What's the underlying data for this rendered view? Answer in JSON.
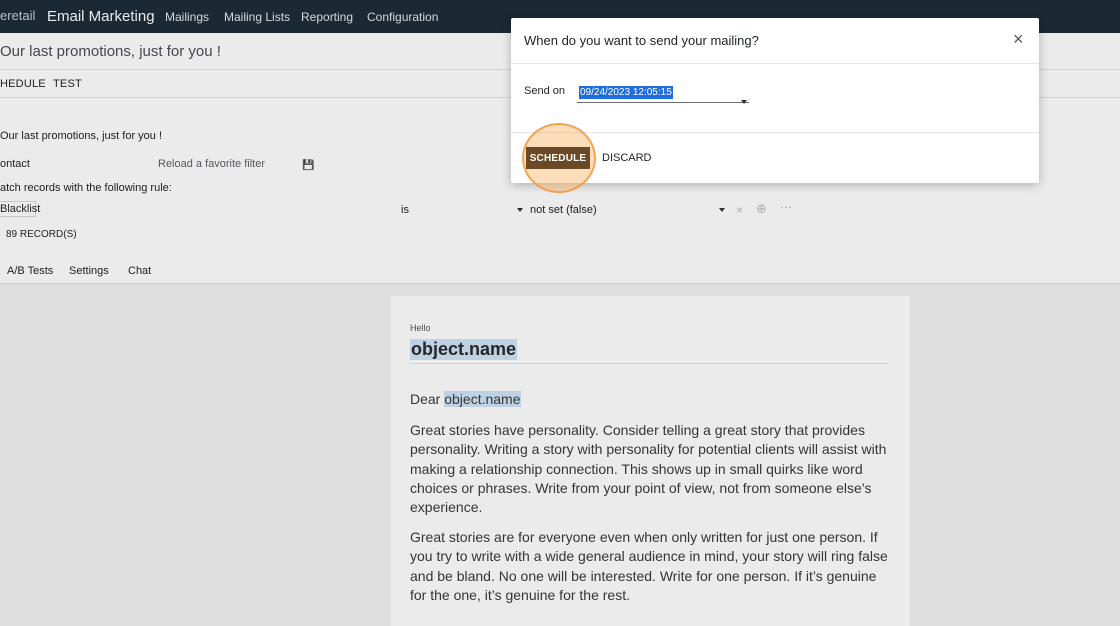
{
  "navbar": {
    "brand": "eretail",
    "app_name": "Email Marketing",
    "menu": [
      "Mailings",
      "Mailing Lists",
      "Reporting",
      "Configuration"
    ]
  },
  "form": {
    "title": "Our last promotions, just for you !",
    "buttons": [
      "HEDULE",
      "TEST"
    ],
    "subject": "Our last promotions, just for you !",
    "recipients": "ontact",
    "reload_filter": "Reload a favorite filter",
    "rule_intro": "atch records with the following rule:",
    "rule_field": "Blacklist",
    "rule_operator": "is",
    "rule_value": "not set (false)",
    "record_count": "89 RECORD(S)",
    "tabs": [
      "A/B Tests",
      "Settings",
      "Chat"
    ]
  },
  "email": {
    "hello": "Hello",
    "heading": "object.name",
    "dear_prefix": "Dear ",
    "dear_name": "object.name",
    "paragraph1": "Great stories have personality. Consider telling a great story that provides personality. Writing a story with personality for potential clients will assist with making a relationship connection. This shows up in small quirks like word choices or phrases. Write from your point of view, not from someone else's experience.",
    "paragraph2": "Great stories are for everyone even when only written for just one person. If you try to write with a wide general audience in mind, your story will ring false and be bland. No one will be interested. Write for one person. If it’s genuine for the one, it’s genuine for the rest."
  },
  "modal": {
    "title": "When do you want to send your mailing?",
    "close": "×",
    "send_label": "Send on",
    "send_date": "09/24/2023 12:05:15",
    "schedule_label": "SCHEDULE",
    "discard_label": "DISCARD"
  },
  "colors": {
    "navbar": "#1e2d3a",
    "schedule_button": "#6a4a26",
    "highlight": "#f8b464",
    "selection": "#1e6fd9"
  }
}
